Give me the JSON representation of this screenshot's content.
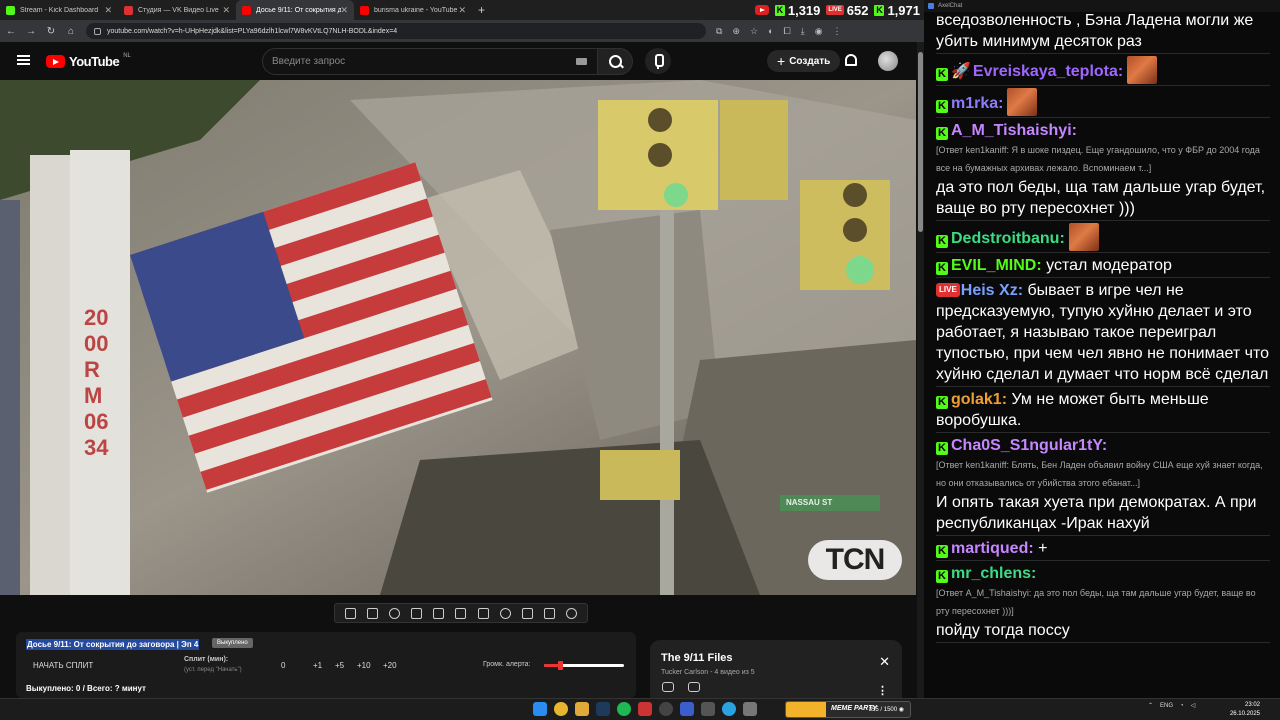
{
  "browser": {
    "tabs": [
      {
        "title": "Stream - Kick Dashboard",
        "color": "#53fc18",
        "active": false
      },
      {
        "title": "Студия — VK Видео Live",
        "color": "#e03131",
        "active": false
      },
      {
        "title": "Досье 9/11: От сокрытия до з",
        "color": "#ff0000",
        "active": true
      },
      {
        "title": "burisma ukraine - YouTube",
        "color": "#ff0000",
        "active": false
      }
    ],
    "new_tab": "+",
    "url": "youtube.com/watch?v=h-UHpHezjdk&list=PLYa96dzlh1lcwl7W8vKVtLQ7NLH-BODL&index=4",
    "counters": {
      "kick": "1,319",
      "vk_label": "LIVE",
      "vk": "652",
      "youtube": "1,971"
    }
  },
  "youtube": {
    "logo_text": "YouTube",
    "region": "NL",
    "search_placeholder": "Введите запрос",
    "create_label": "Создать"
  },
  "video": {
    "watermark": "TCN",
    "pole_text": "2000RM0634",
    "street_sign": "NASSAU ST"
  },
  "panel": {
    "title": "Досье 9/11: От сокрытия до заговора | Эп 4",
    "badge": "Выкуплено",
    "start_split": "НАЧАТЬ СПЛИТ",
    "split_label": "Сплит (мин):",
    "split_hint": "(уст. перед \"Начать\")",
    "split_values": [
      "0",
      "+1",
      "+5",
      "+10",
      "+20"
    ],
    "alert_label": "Громк. алерта:",
    "alert_volume": 0.2,
    "bought": "Выкуплено: 0 / Всего: ? минут"
  },
  "playlist": {
    "title": "The 9/11 Files",
    "subtitle": "Tucker Carlson - 4 видео из 5"
  },
  "chat": {
    "header": "AxelChat",
    "messages": [
      {
        "platform": "none",
        "user": "",
        "color": "#ffffff",
        "reply": "",
        "text": "вседозволенность , Бэна Ладена могли же убить минимум десяток раз",
        "emote": false
      },
      {
        "platform": "kick",
        "user": "Evreiskaya_teplota:",
        "color": "#a066ff",
        "reply": "",
        "text": "",
        "emote": true,
        "rocket": true
      },
      {
        "platform": "kick",
        "user": "m1rka:",
        "color": "#8e7cff",
        "reply": "",
        "text": "",
        "emote": true
      },
      {
        "platform": "kick",
        "user": "A_M_Tishaishyi:",
        "color": "#c586ff",
        "reply": "[Ответ ken1kaniff: Я в шоке пиздец. Еще угандошило, что у ФБР до 2004 года все на бумажных архивах лежало. Вспоминаем т...]",
        "text": "да это пол беды, ща там дальше угар будет, ваще во рту пересохнет )))",
        "emote": false
      },
      {
        "platform": "kick",
        "user": "Dedstroitbanu:",
        "color": "#3ddc84",
        "reply": "",
        "text": "",
        "emote": true
      },
      {
        "platform": "kick",
        "user": "EVIL_MIND:",
        "color": "#53fc18",
        "reply": "",
        "text": "устал модератор",
        "emote": false
      },
      {
        "platform": "vk",
        "user": "Heis Xz:",
        "color": "#7aa0ff",
        "reply": "",
        "text": "бывает в игре чел не предсказуемую, тупую хуйню делает и это работает, я называю такое переиграл тупостью, при чем чел явно не понимает что хуйню сделал и думает что норм всё сделал",
        "emote": false
      },
      {
        "platform": "kick",
        "user": "golak1:",
        "color": "#f0a030",
        "reply": "",
        "text": "Ум не может быть меньше воробушка.",
        "emote": false
      },
      {
        "platform": "kick",
        "user": "Cha0S_S1ngular1tY:",
        "color": "#c586ff",
        "reply": "[Ответ ken1kaniff: Блять, Бен Ладен объявил войну США еще хуй знает когда, но они отказывались от убийства этого ебанат...]",
        "text": "И опять такая хуета при демократах. А при республиканцах -Ирак нахуй",
        "emote": false
      },
      {
        "platform": "kick",
        "user": "martiqued:",
        "color": "#c586ff",
        "reply": "",
        "text": "+",
        "emote": false
      },
      {
        "platform": "kick",
        "user": "mr_chlens:",
        "color": "#3ddc84",
        "reply": "[Ответ A_M_Tishaishyi: да это пол беды, ща там дальше угар будет, ваще во рту пересохнет )))]",
        "text": "пойду тогда поссу",
        "emote": false
      }
    ]
  },
  "taskbar": {
    "widget_label": "MEME PARTY",
    "widget_value": "355 / 1500 ◉",
    "lang": "ENG",
    "time": "23:02",
    "date": "26.10.2025"
  }
}
